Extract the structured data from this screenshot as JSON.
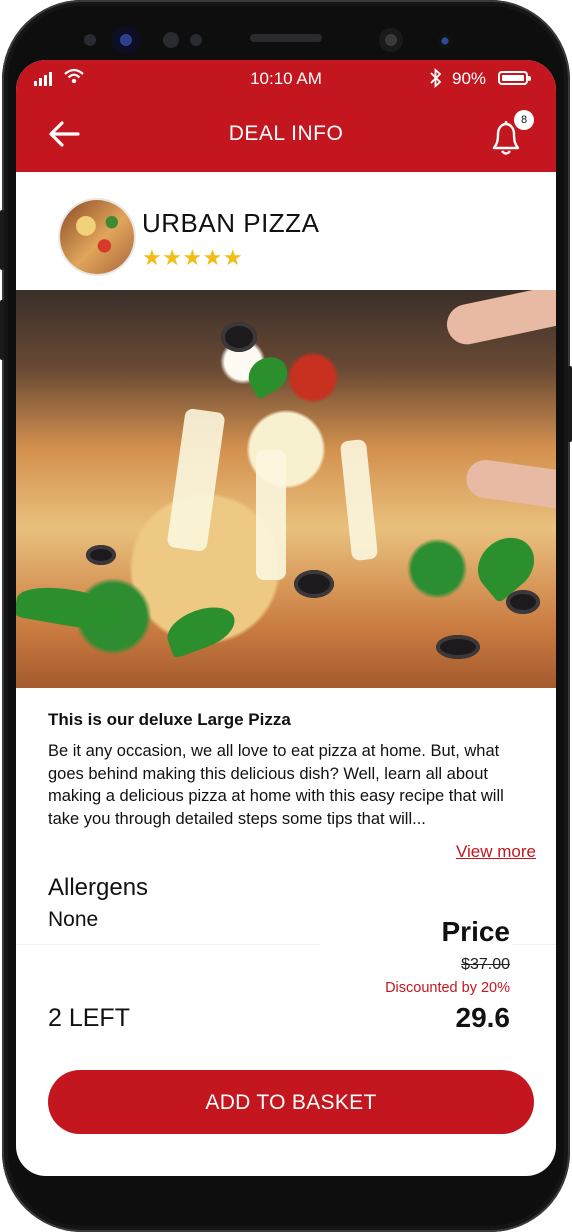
{
  "status_bar": {
    "time": "10:10 AM",
    "battery": "90%"
  },
  "header": {
    "title": "DEAL INFO",
    "notification_count": "8"
  },
  "store": {
    "name": "URBAN PIZZA",
    "rating": "★★★★★"
  },
  "deal": {
    "title": "This is our deluxe Large Pizza",
    "description": "Be it any occasion, we all love to eat pizza at home. But, what goes behind making this delicious dish? Well, learn all about making a delicious pizza at home with this easy recipe that will take you through detailed steps some tips that will...",
    "view_more": "View more"
  },
  "allergens": {
    "label": "Allergens",
    "value": "None"
  },
  "stock": {
    "text": "2 LEFT"
  },
  "price": {
    "label": "Price",
    "original": "$37.00",
    "discount": "Discounted by 20%",
    "final": "29.6"
  },
  "cta": {
    "label": "ADD TO BASKET"
  },
  "colors": {
    "brand": "#c4161f",
    "star": "#f2bd18"
  }
}
